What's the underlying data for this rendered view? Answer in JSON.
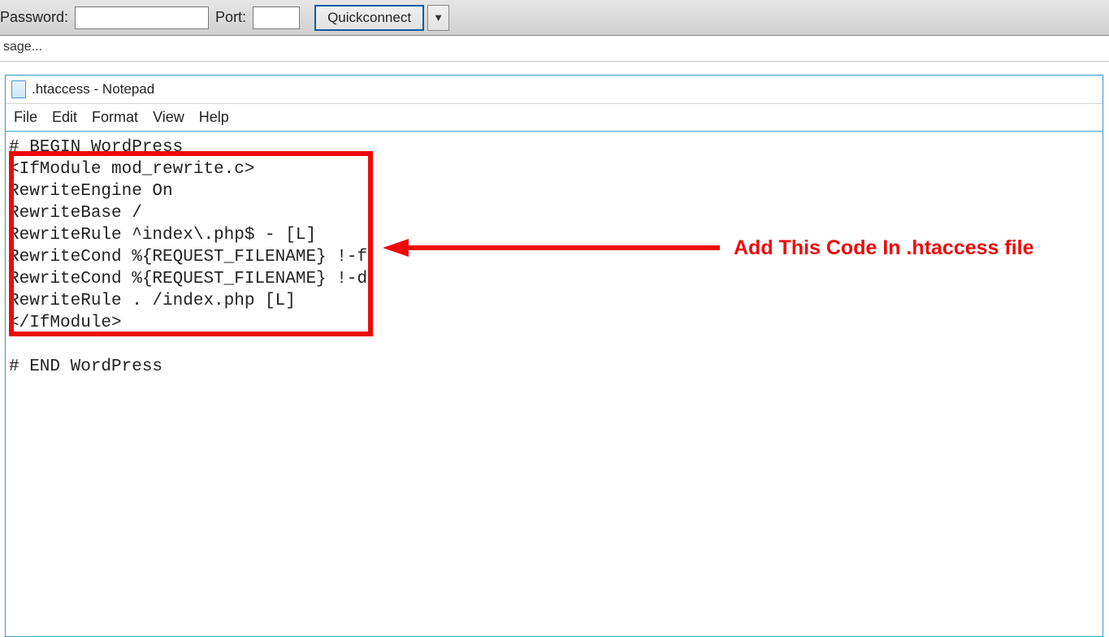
{
  "toolbar": {
    "password_label": "Password:",
    "password_value": "",
    "port_label": "Port:",
    "port_value": "",
    "quickconnect_label": "Quickconnect"
  },
  "status_bar": {
    "text": "sage..."
  },
  "notepad": {
    "title": ".htaccess - Notepad",
    "menu": {
      "file": "File",
      "edit": "Edit",
      "format": "Format",
      "view": "View",
      "help": "Help"
    },
    "lines": {
      "l1": "# BEGIN WordPress",
      "l2": "<IfModule mod_rewrite.c>",
      "l3": "RewriteEngine On",
      "l4": "RewriteBase /",
      "l5": "RewriteRule ^index\\.php$ - [L]",
      "l6": "RewriteCond %{REQUEST_FILENAME} !-f",
      "l7": "RewriteCond %{REQUEST_FILENAME} !-d",
      "l8": "RewriteRule . /index.php [L]",
      "l9": "</IfModule>",
      "l10": "",
      "l11": "# END WordPress"
    }
  },
  "annotation": {
    "text": "Add This Code In .htaccess file"
  }
}
